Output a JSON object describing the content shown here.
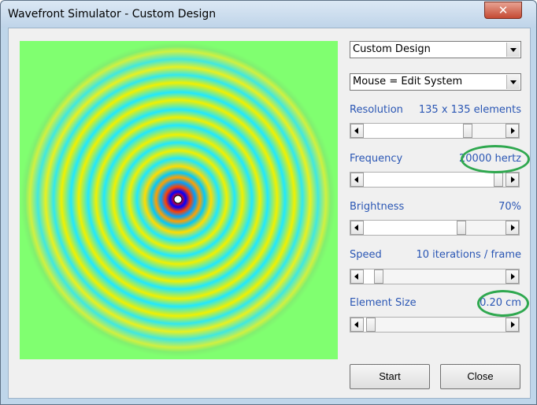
{
  "window": {
    "title": "Wavefront Simulator - Custom Design",
    "close_glyph": "✕"
  },
  "controls": {
    "design_select": "Custom Design",
    "mouse_mode_select": "Mouse = Edit System",
    "resolution": {
      "label": "Resolution",
      "value": "135 x 135 elements",
      "level": 0.75
    },
    "frequency": {
      "label": "Frequency",
      "value": "20000 hertz",
      "level": 0.98
    },
    "brightness": {
      "label": "Brightness",
      "value": "70%",
      "level": 0.7
    },
    "speed": {
      "label": "Speed",
      "value": "10 iterations / frame",
      "level": 0.08
    },
    "element_size": {
      "label": "Element Size",
      "value": "0.20 cm",
      "level": 0.02
    }
  },
  "buttons": {
    "start": "Start",
    "close": "Close"
  },
  "colors": {
    "label_blue": "#2a56b4",
    "highlight_green": "#2fa84f"
  }
}
